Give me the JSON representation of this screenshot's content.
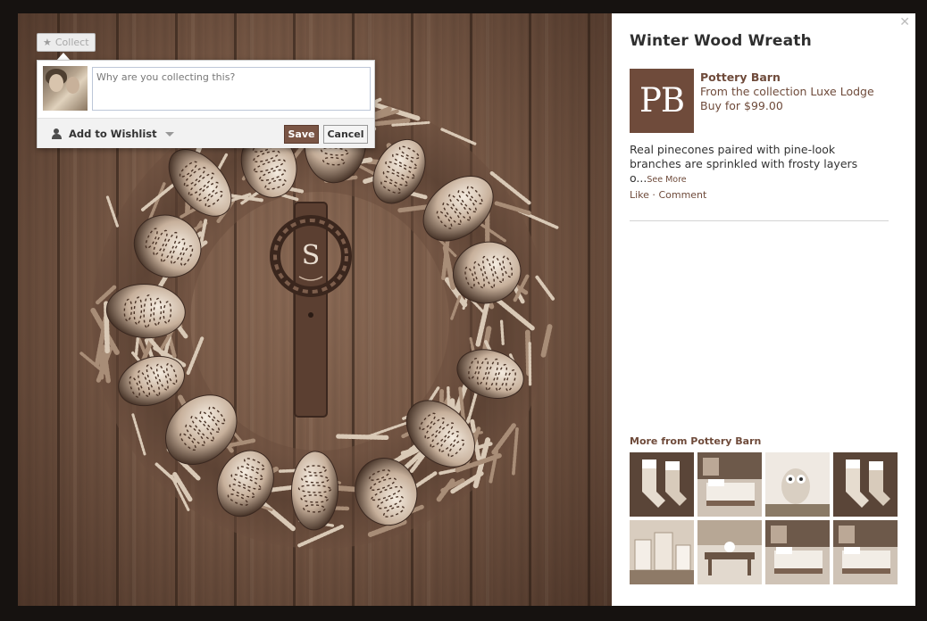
{
  "collect": {
    "label": "Collect",
    "placeholder": "Why are you collecting this?",
    "wishlist_label": "Add to Wishlist",
    "save_label": "Save",
    "cancel_label": "Cancel"
  },
  "photo": {
    "monogram": "S"
  },
  "product": {
    "title": "Winter Wood Wreath",
    "brand_initials": "PB",
    "brand_name": "Pottery Barn",
    "collection": "From the collection Luxe Lodge",
    "price": "Buy for $99.00",
    "description": "Real pinecones paired with pine-look branches are sprinkled with frosty layers o...",
    "see_more": "See More",
    "like": "Like",
    "separator": " · ",
    "comment": "Comment"
  },
  "more_from": {
    "heading": "More from Pottery Barn",
    "thumbnails": [
      "stockings",
      "bedroom",
      "owl",
      "stockings",
      "canisters",
      "dining",
      "bedroom",
      "bedroom"
    ]
  },
  "colors": {
    "accent": "#6f4b3b",
    "save_button": "#7a5545",
    "sepia_bg": "#725442"
  },
  "icons": {
    "close": "close-icon",
    "star": "star-icon",
    "person": "person-icon",
    "chevron": "chevron-down-icon"
  }
}
